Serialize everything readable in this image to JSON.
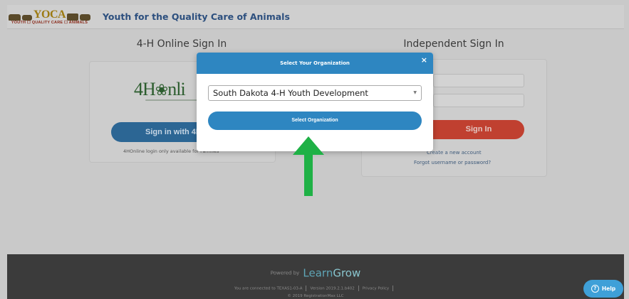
{
  "header": {
    "logo_word": "YOCA",
    "logo_sub": "YOUTH ☐ QUALITY CARE ☐ ANIMALS",
    "site_title": "Youth for the Quality Care of Animals"
  },
  "left_column": {
    "title": "4-H Online Sign In",
    "brand_text": "4H",
    "brand_clover": "❀",
    "brand_tail": "nli",
    "button_label": "Sign in with 4H",
    "note": "4HOnline login only available for Families"
  },
  "right_column": {
    "title": "Independent Sign In",
    "sign_in_label": "Sign In",
    "create_account_link": "Create a new account",
    "forgot_link": "Forgot username or password?"
  },
  "modal": {
    "title": "Select Your Organization",
    "close_label": "×",
    "selected_org": "South Dakota 4-H Youth Development",
    "select_button_label": "Select Organization"
  },
  "footer": {
    "powered_by": "Powered by",
    "brand_a": "Learn",
    "brand_b": "Grow",
    "connection": "You are connected to TEXAS1-03-A",
    "version": "Version 2019.2.1.b402",
    "privacy": "Privacy Policy",
    "copyright": "© 2019 RegistrationMax LLC",
    "help_label": "Help"
  },
  "colors": {
    "modal_accent": "#2e86c1",
    "sign_in_red": "#c04030",
    "fourh_blue": "#2c6694",
    "arrow_green": "#1fb146"
  }
}
